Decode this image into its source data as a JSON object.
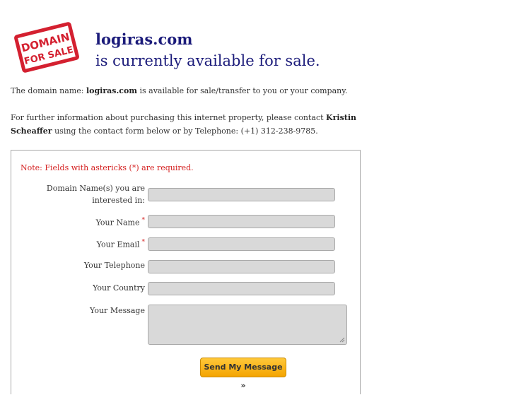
{
  "stamp": {
    "line1": "DOMAIN",
    "line2": "FOR SALE"
  },
  "header": {
    "domain": "logiras.com",
    "availability": "is currently available for sale."
  },
  "intro": {
    "prefix": "The domain name: ",
    "domain": "logiras.com",
    "suffix": " is available for sale/transfer to you or your company."
  },
  "contact": {
    "prefix": "For further information about purchasing this internet property, please contact ",
    "name": "Kristin Scheaffer",
    "suffix": " using the contact form below or by Telephone: (+1) 312-238-9785."
  },
  "form": {
    "note": "Note: Fields with astericks (*) are required.",
    "domain_label": "Domain Name(s) you are interested in:",
    "name_label": "Your Name",
    "email_label": "Your Email",
    "telephone_label": "Your Telephone",
    "country_label": "Your Country",
    "message_label": "Your Message",
    "required_mark": "*",
    "submit_label": "Send My Message »"
  },
  "colors": {
    "accent": "#1b1b7a",
    "required": "#d42020",
    "button": "#f4a400",
    "stamp": "#d42030"
  }
}
